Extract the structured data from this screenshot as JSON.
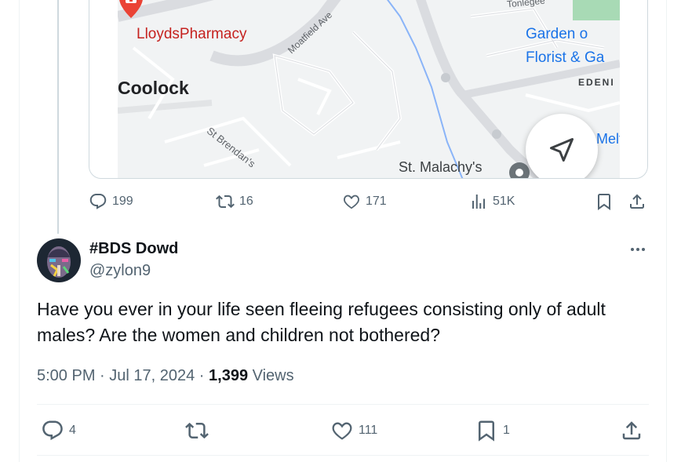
{
  "map": {
    "labels": {
      "pharmacy": "LloydsPharmacy",
      "town": "Coolock",
      "street1": "Moatfield Ave",
      "street2": "St Brendan's",
      "church": "St. Malachy's",
      "florist_line1": "Garden o",
      "florist_line2": "Florist & Ga",
      "area": "EDENI",
      "place": "Melt",
      "road": "Tonlegee"
    },
    "icons": {
      "pharmacy": "pharmacy-pin-icon",
      "navigate": "navigation-arrow-icon",
      "place": "place-marker-icon"
    },
    "colors": {
      "pharmacy_pin": "#ea4335",
      "water": "#8ab4f8",
      "park": "#a8dab5"
    }
  },
  "tweet1_actions": {
    "replies": "199",
    "reposts": "16",
    "likes": "171",
    "views": "51K"
  },
  "tweet2": {
    "display_name": "#BDS Dowd",
    "handle": "@zylon9",
    "text": "Have you ever in your life seen fleeing refugees consisting only of adult males? Are the women and children not bothered?",
    "time": "5:00 PM · Jul 17, 2024 · ",
    "views_count": "1,399",
    "views_label": " Views",
    "actions": {
      "replies": "4",
      "likes": "111",
      "bookmarks": "1"
    }
  },
  "colors": {
    "text": "#0f1419",
    "secondary": "#536471",
    "border": "#eff3f4"
  }
}
